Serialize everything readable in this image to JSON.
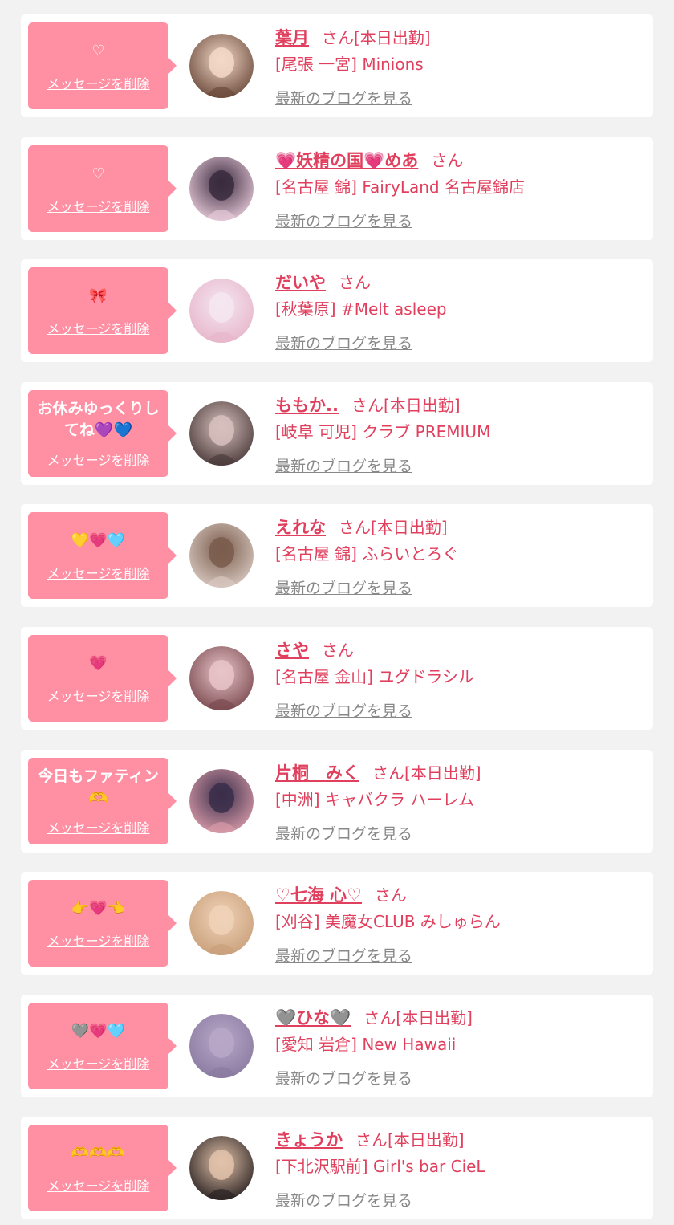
{
  "labels": {
    "delete": "メッセージを削除",
    "blog": "最新のブログを見る",
    "san": "さん",
    "today": "[本日出勤]"
  },
  "cards": [
    {
      "message": "♡",
      "name": "葉月",
      "shop": "[尾張 一宮] Minions",
      "today": true,
      "avatar_colors": [
        "#f3d8c8",
        "#6b4a3a"
      ]
    },
    {
      "message": "♡",
      "name": "💗妖精の国💗めあ",
      "shop": "[名古屋 錦] FairyLand 名古屋錦店",
      "today": false,
      "avatar_colors": [
        "#3a2a3e",
        "#e6c9d8"
      ]
    },
    {
      "message": "🎀",
      "name": "だいや",
      "shop": "[秋葉原] #Melt asleep",
      "today": false,
      "avatar_colors": [
        "#f4e6f0",
        "#e7b6cb"
      ]
    },
    {
      "message": "お休みゆっくりしてね💜💙",
      "name": "ももか..",
      "shop": "[岐阜 可児] クラブ PREMIUM",
      "today": true,
      "avatar_colors": [
        "#d7c0bd",
        "#4a3a3a"
      ]
    },
    {
      "message": "💛💗🩵",
      "name": "えれな",
      "shop": "[名古屋 錦] ふらいとろぐ",
      "today": true,
      "avatar_colors": [
        "#7a5c4c",
        "#d8c8c0"
      ]
    },
    {
      "message": "💗",
      "name": "さや",
      "shop": "[名古屋 金山] ユグドラシル",
      "today": false,
      "avatar_colors": [
        "#e8c4c8",
        "#7a4a50"
      ]
    },
    {
      "message": "今日もファティン🫶",
      "name": "片桐　みく",
      "shop": "[中洲] キャバクラ ハーレム",
      "today": true,
      "avatar_colors": [
        "#3a2e4a",
        "#d89aa8"
      ]
    },
    {
      "message": "👉💗👈",
      "name": "♡七海 心♡",
      "shop": "[刈谷] 美魔女CLUB みしゅらん",
      "today": false,
      "avatar_colors": [
        "#f0d2b8",
        "#c9a07a"
      ]
    },
    {
      "message": "🩶💗🩵",
      "name": "🩶ひな🩶",
      "shop": "[愛知 岩倉] New Hawaii",
      "today": true,
      "avatar_colors": [
        "#b8a8c8",
        "#8a7aa0"
      ]
    },
    {
      "message": "🫶🫶🫶",
      "name": "きょうか",
      "shop": "[下北沢駅前] Girl's bar CieL",
      "today": true,
      "avatar_colors": [
        "#e2c2aa",
        "#2a2222"
      ]
    }
  ]
}
